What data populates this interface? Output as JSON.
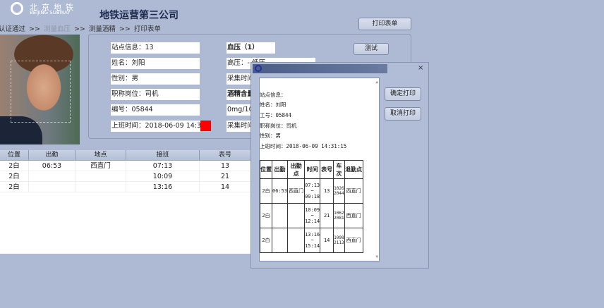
{
  "header": {
    "logo_cn": "北京地铁",
    "logo_en": "BEIJING SUBWAY",
    "title": "地铁运营第三公司"
  },
  "breadcrumb": {
    "items": [
      "认证通过",
      "测量血压",
      "测量酒精",
      "打印表单"
    ],
    "sep": ">>"
  },
  "buttons": {
    "print_form": "打印表单",
    "test": "测试"
  },
  "info": {
    "station": "站点信息：13",
    "name": "姓名：刘阳",
    "gender": "性别：男",
    "position": "职称岗位：司机",
    "number": "编号：05844",
    "shift_time": "上班时间：2018-06-09 14:31:15",
    "bp_title": "血压（1）",
    "bp_value": "高压：- 低压",
    "bp_time": "采集时间",
    "alcohol_title": "酒精含量",
    "alcohol_value": "0mg/100",
    "alcohol_time": "采集时间",
    "status_color": "#ff0000"
  },
  "grid": {
    "headers": [
      "位置",
      "出勤",
      "地点",
      "接班",
      "表号"
    ],
    "rows": [
      [
        "2白",
        "06:53",
        "西直门",
        "07:13",
        "13"
      ],
      [
        "2白",
        "",
        "",
        "10:09",
        "21"
      ],
      [
        "2白",
        "",
        "",
        "13:16",
        "14"
      ]
    ]
  },
  "dialog": {
    "close": "×",
    "confirm": "确定打印",
    "cancel": "取消打印",
    "doc": {
      "station": "站点信息：",
      "name": "姓名：刘阳",
      "id": "工号：05844",
      "position": "职称岗位：司机",
      "gender": "性别：男",
      "shift": "上班时间：2018-06-09 14:31:15",
      "table_headers": [
        "位置",
        "出勤",
        "出勤点",
        "时间",
        "表号",
        "车次",
        "退勤点"
      ],
      "rows": [
        {
          "pos": "2白",
          "on": "06:53",
          "on_pt": "西直门",
          "t1": "07:13",
          "tilde": "~",
          "t2": "09:18",
          "no": "13",
          "tr1": "1026",
          "tr2": "2044",
          "off_pt": "西直门"
        },
        {
          "pos": "2白",
          "on": "",
          "on_pt": "",
          "t1": "10:09",
          "tilde": "~",
          "t2": "12:14",
          "no": "21",
          "tr1": "1062",
          "tr2": "2081",
          "off_pt": "西直门"
        },
        {
          "pos": "2白",
          "on": "",
          "on_pt": "",
          "t1": "13:16",
          "tilde": "~",
          "t2": "15:14",
          "no": "14",
          "tr1": "1098",
          "tr2": "2113",
          "off_pt": "西直门"
        }
      ]
    }
  }
}
